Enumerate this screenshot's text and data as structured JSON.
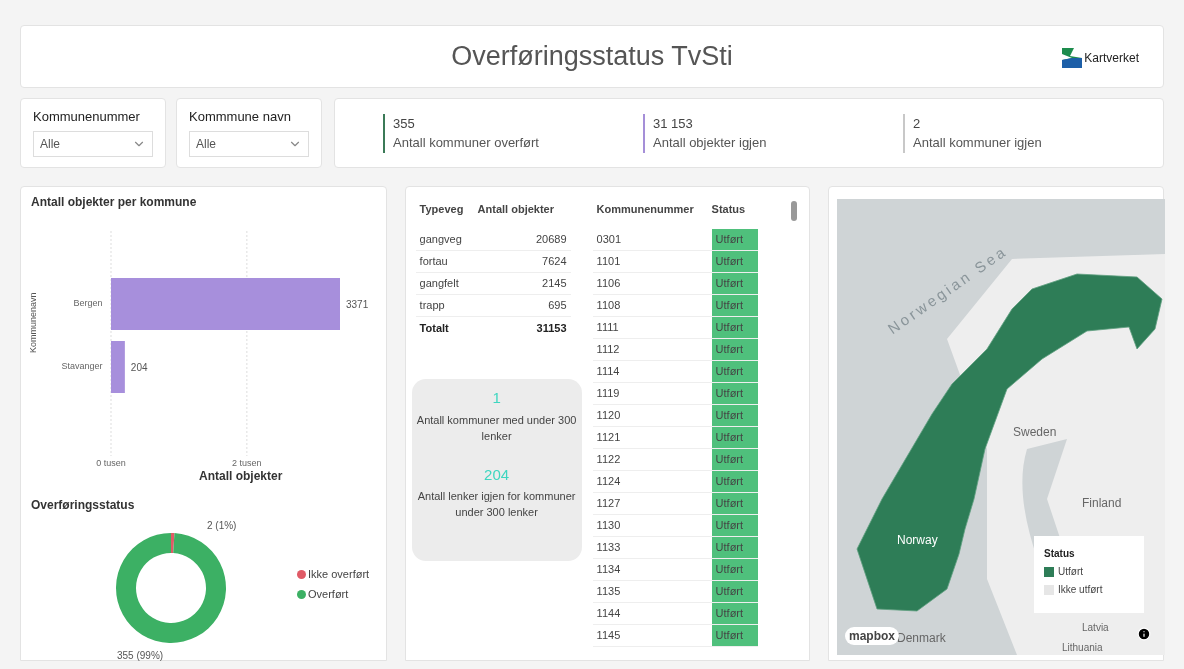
{
  "header": {
    "title": "Overføringsstatus TvSti",
    "logo_text": "Kartverket"
  },
  "filters": [
    {
      "label": "Kommunenummer",
      "value": "Alle"
    },
    {
      "label": "Kommmune navn",
      "value": "Alle"
    }
  ],
  "kpis": [
    {
      "value": "355",
      "label": "Antall kommuner overført",
      "color": "#3b7a57"
    },
    {
      "value": "31 153",
      "label": "Antall objekter igjen",
      "color": "#a58fd8"
    },
    {
      "value": "2",
      "label": "Antall kommuner igjen",
      "color": "#c8c8c8"
    }
  ],
  "bar_chart": {
    "chart_data": {
      "type": "bar",
      "title": "Antall objekter per kommune",
      "orientation": "horizontal",
      "xlabel": "Antall objekter",
      "ylabel": "Kommunenavn",
      "categories": [
        "Bergen",
        "Stavanger"
      ],
      "series": [
        {
          "color": "#a78fdc",
          "values": [
            3.371,
            0.204
          ]
        }
      ],
      "xlim": [
        0,
        3.371
      ],
      "xticks": [
        {
          "value": 0,
          "label": "0 tusen"
        },
        {
          "value": 2,
          "label": "2 tusen"
        }
      ],
      "value_labels": [
        "3371",
        "204"
      ]
    }
  },
  "donut_chart": {
    "chart_data": {
      "type": "donut",
      "title": "Overføringsstatus",
      "categories": [
        "Ikke overført",
        "Overført"
      ],
      "series": [
        {
          "values": [
            1,
            99
          ]
        }
      ],
      "colors": [
        "#e05a66",
        "#3cb064"
      ],
      "value_labels": [
        "2 (1%)",
        "355 (99%)"
      ],
      "legend": "right"
    }
  },
  "type_table": {
    "columns": [
      "Typeveg",
      "Antall objekter"
    ],
    "rows": [
      [
        "gangveg",
        "20689"
      ],
      [
        "fortau",
        "7624"
      ],
      [
        "gangfelt",
        "2145"
      ],
      [
        "trapp",
        "695"
      ]
    ],
    "total": [
      "Totalt",
      "31153"
    ]
  },
  "info_card": [
    {
      "value": "1",
      "label": "Antall kommuner med under 300 lenker"
    },
    {
      "value": "204",
      "label": "Antall lenker igjen for kommuner under 300 lenker"
    }
  ],
  "status_table": {
    "columns": [
      "Kommunenummer",
      "Status"
    ],
    "rows": [
      {
        "number": "0301",
        "status": "Utført",
        "done": true
      },
      {
        "number": "1101",
        "status": "Utført",
        "done": true
      },
      {
        "number": "1106",
        "status": "Utført",
        "done": true
      },
      {
        "number": "1108",
        "status": "Utført",
        "done": true
      },
      {
        "number": "1111",
        "status": "Utført",
        "done": true
      },
      {
        "number": "1112",
        "status": "Utført",
        "done": true
      },
      {
        "number": "1114",
        "status": "Utført",
        "done": true
      },
      {
        "number": "1119",
        "status": "Utført",
        "done": true
      },
      {
        "number": "1120",
        "status": "Utført",
        "done": true
      },
      {
        "number": "1121",
        "status": "Utført",
        "done": true
      },
      {
        "number": "1122",
        "status": "Utført",
        "done": true
      },
      {
        "number": "1124",
        "status": "Utført",
        "done": true
      },
      {
        "number": "1127",
        "status": "Utført",
        "done": true
      },
      {
        "number": "1130",
        "status": "Utført",
        "done": true
      },
      {
        "number": "1133",
        "status": "Utført",
        "done": true
      },
      {
        "number": "1134",
        "status": "Utført",
        "done": true
      },
      {
        "number": "1135",
        "status": "Utført",
        "done": true
      },
      {
        "number": "1144",
        "status": "Utført",
        "done": true
      },
      {
        "number": "1145",
        "status": "Utført",
        "done": true
      }
    ]
  },
  "map": {
    "labels": [
      {
        "text": "Norwegian Sea",
        "kind": "sea"
      },
      {
        "text": "Sweden",
        "kind": "country"
      },
      {
        "text": "Finland",
        "kind": "country"
      },
      {
        "text": "Norway",
        "kind": "country"
      },
      {
        "text": "Latvia",
        "kind": "country"
      },
      {
        "text": "Denmark",
        "kind": "country"
      },
      {
        "text": "Lithuania",
        "kind": "country"
      }
    ],
    "attribution": "mapbox",
    "legend": {
      "title": "Status",
      "items": [
        {
          "label": "Utført",
          "color": "#2e7d57"
        },
        {
          "label": "Ikke utført",
          "color": "#e6e6e6"
        }
      ]
    }
  }
}
